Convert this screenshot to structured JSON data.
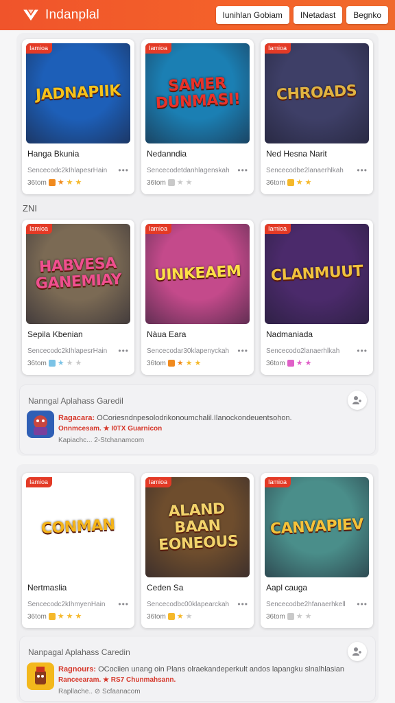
{
  "header": {
    "brand": "Indanplal",
    "buttons": [
      "Iunihlan Gobiam",
      "INetadast",
      "Begnko"
    ],
    "color": "#f0542b"
  },
  "section_label": "ZNI",
  "rows": [
    {
      "cards": [
        {
          "badge": "Iamioa",
          "thumb_text": "JADNAPIIK",
          "title": "Hanga Bkunia",
          "subtitle": "Sencecodc2kIhlapesrHain",
          "meta": "36tom",
          "icon": "game-art-cartoon",
          "bg": "#1d5fb8",
          "fg": "#f6c21a",
          "stars": [
            "#f08a1e",
            "#f5b82a",
            "#f5b82a"
          ]
        },
        {
          "badge": "Iamioa",
          "thumb_text": "SAMER DUNMASI!",
          "title": "Nedanndia",
          "subtitle": "Sencecodetdanhlagenskah",
          "meta": "36tom",
          "icon": "game-art-title",
          "bg": "#1b7fb3",
          "fg": "#e8322a",
          "stars": [
            "#c9c9c9",
            "#c9c9c9"
          ]
        },
        {
          "badge": "Iamioa",
          "thumb_text": "CHROADS",
          "title": "Ned Hesna Narit",
          "subtitle": "Sencecodbe2lanaerhlkah",
          "meta": "36tom",
          "icon": "game-art-robot",
          "bg": "#3e3f67",
          "fg": "#e0b341",
          "stars": [
            "#f5b82a",
            "#f5b82a"
          ]
        }
      ]
    },
    {
      "cards": [
        {
          "badge": "Iamioa",
          "thumb_text": "HABVESA GANEMIAY",
          "title": "Sepila Kbenian",
          "subtitle": "Sencecodc2kIhlapesrHain",
          "meta": "36tom",
          "icon": "game-art-cars",
          "bg": "#7b6a54",
          "fg": "#ef4f8f",
          "stars": [
            "#7cc3e6",
            "#c9c9c9",
            "#c9c9c9"
          ]
        },
        {
          "badge": "Iamioa",
          "thumb_text": "UINKEAEM",
          "title": "Nàua Eara",
          "subtitle": "Sencecodar30klapenyckah",
          "meta": "36tom",
          "icon": "game-art-warriors",
          "bg": "#c44a8b",
          "fg": "#fde047",
          "stars": [
            "#f08a1e",
            "#f5b82a",
            "#f5b82a"
          ]
        },
        {
          "badge": "Iamioa",
          "thumb_text": "CLANMUUT",
          "title": "Nadmaniada",
          "subtitle": "Sencecodo2lanaerhlkah",
          "meta": "36tom",
          "icon": "game-art-dragon",
          "bg": "#4b2a6b",
          "fg": "#f0c23d",
          "stars": [
            "#e060c8",
            "#e060c8"
          ]
        }
      ]
    },
    {
      "cards": [
        {
          "badge": "Iamioa",
          "thumb_text": "CONMAN",
          "title": "Nertmaslia",
          "subtitle": "Sencecodc2kIhmyenHain",
          "meta": "36tom",
          "icon": "game-art-mascots",
          "bg": "#ffffff",
          "fg": "#f4b41a",
          "stars": [
            "#f5b82a",
            "#f5b82a",
            "#f5b82a"
          ]
        },
        {
          "badge": "Iamioa",
          "thumb_text": "ALAND BAAN EONEOUS",
          "title": "Ceden Sa",
          "subtitle": "Sencecodbc00klapearckah",
          "meta": "36tom",
          "icon": "game-art-city",
          "bg": "#6e4d2d",
          "fg": "#f2d36b",
          "stars": [
            "#f5b82a",
            "#c9c9c9"
          ]
        },
        {
          "badge": "Iamioa",
          "thumb_text": "CANVAPIEV",
          "title": "Aapl cauga",
          "subtitle": "Sencecodbe2hfanaerhkell",
          "meta": "36tom",
          "icon": "game-art-castle",
          "bg": "#4a8e8a",
          "fg": "#f4c23a",
          "stars": [
            "#c9c9c9",
            "#c9c9c9"
          ]
        }
      ]
    }
  ],
  "promos": [
    {
      "heading": "Nanngal Aplahass Garedil",
      "highlight": "Ragacara:",
      "text": "OCoriesndnpesolodrikonoumchalil.Ilanockondeuentsohon.",
      "line2": "Onnmcesam. ★ I0TX Guarnicon",
      "line3": "Kapiachc... 2-Stchanamcom"
    },
    {
      "heading": "Nanpagal Aplahass Caredin",
      "highlight": "Ragnours:",
      "text": "OCociien unang oin Plans olraekandeperkult andos lapangku slnalhlasian",
      "line2": "Ranceearam. ★ RS7 Chunmahsann.",
      "line3": "Rapllache.. ⊘ Scfaanacom"
    }
  ]
}
